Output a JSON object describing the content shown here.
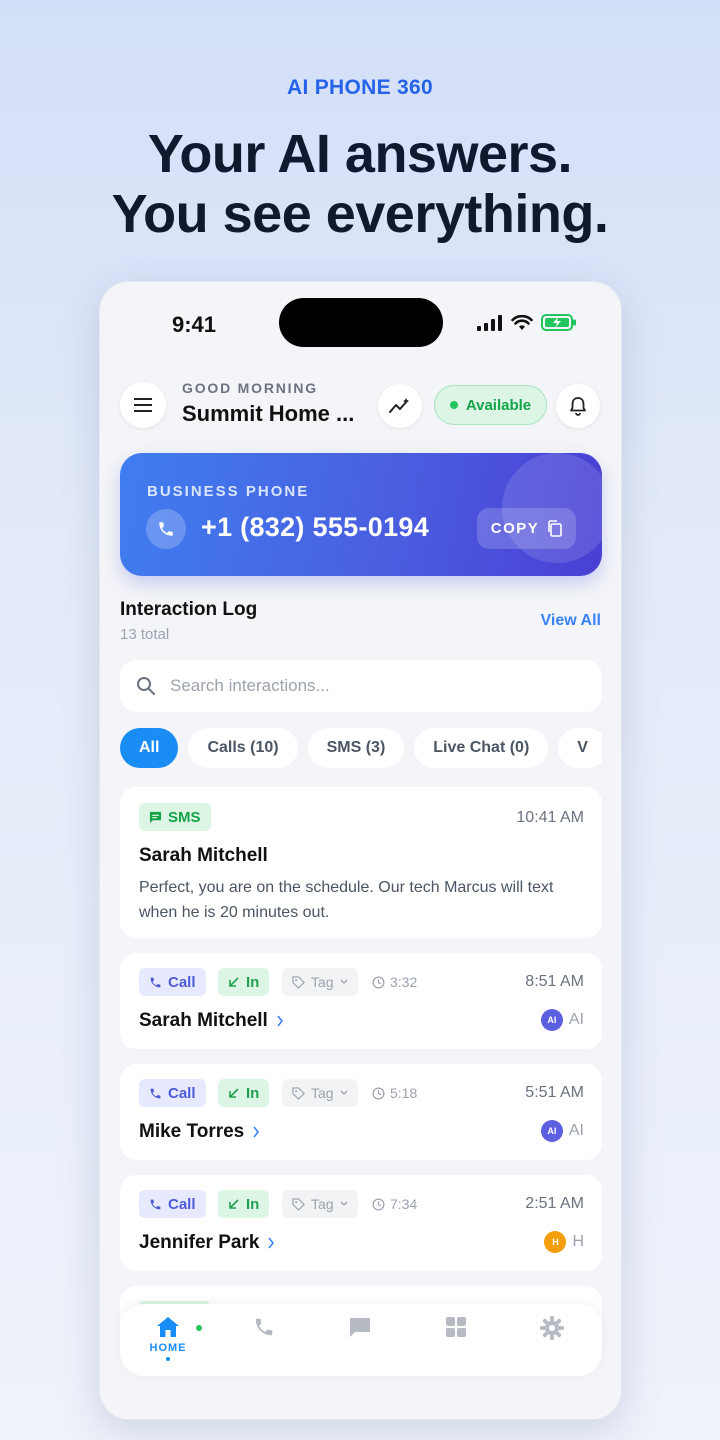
{
  "promo": {
    "brand": "AI PHONE 360",
    "headline_line1": "Your AI answers.",
    "headline_line2": "You see everything."
  },
  "status_bar": {
    "time": "9:41"
  },
  "header": {
    "greeting": "GOOD MORNING",
    "business_name": "Summit Home ...",
    "availability": "Available"
  },
  "business_card": {
    "label": "BUSINESS PHONE",
    "number": "+1 (832) 555-0194",
    "copy_label": "COPY"
  },
  "log": {
    "title": "Interaction Log",
    "count": "13 total",
    "view_all": "View All",
    "search_placeholder": "Search interactions..."
  },
  "filters": [
    "All",
    "Calls (10)",
    "SMS (3)",
    "Live Chat (0)",
    "V"
  ],
  "interactions": [
    {
      "type": "SMS",
      "time": "10:41 AM",
      "name": "Sarah Mitchell",
      "preview": "Perfect, you are on the schedule. Our tech Marcus will text when he is 20 minutes out."
    },
    {
      "type": "Call",
      "direction": "In",
      "tag": "Tag",
      "duration": "3:32",
      "time": "8:51 AM",
      "name": "Sarah Mitchell",
      "agent_badge": "AI",
      "agent": "AI"
    },
    {
      "type": "Call",
      "direction": "In",
      "tag": "Tag",
      "duration": "5:18",
      "time": "5:51 AM",
      "name": "Mike Torres",
      "agent_badge": "AI",
      "agent": "AI"
    },
    {
      "type": "Call",
      "direction": "In",
      "tag": "Tag",
      "duration": "7:34",
      "time": "2:51 AM",
      "name": "Jennifer Park",
      "agent_badge": "H",
      "agent": "H"
    }
  ],
  "nav": {
    "home_label": "HOME",
    "items": [
      "home-icon",
      "phone-icon",
      "chat-icon",
      "grid-icon",
      "settings-icon"
    ]
  },
  "colors": {
    "accent": "#1a8cf5",
    "brand": "#2563eb",
    "available": "#16a34a",
    "ai_avatar": "#5b5fe0",
    "human_avatar": "#f59e0b"
  }
}
